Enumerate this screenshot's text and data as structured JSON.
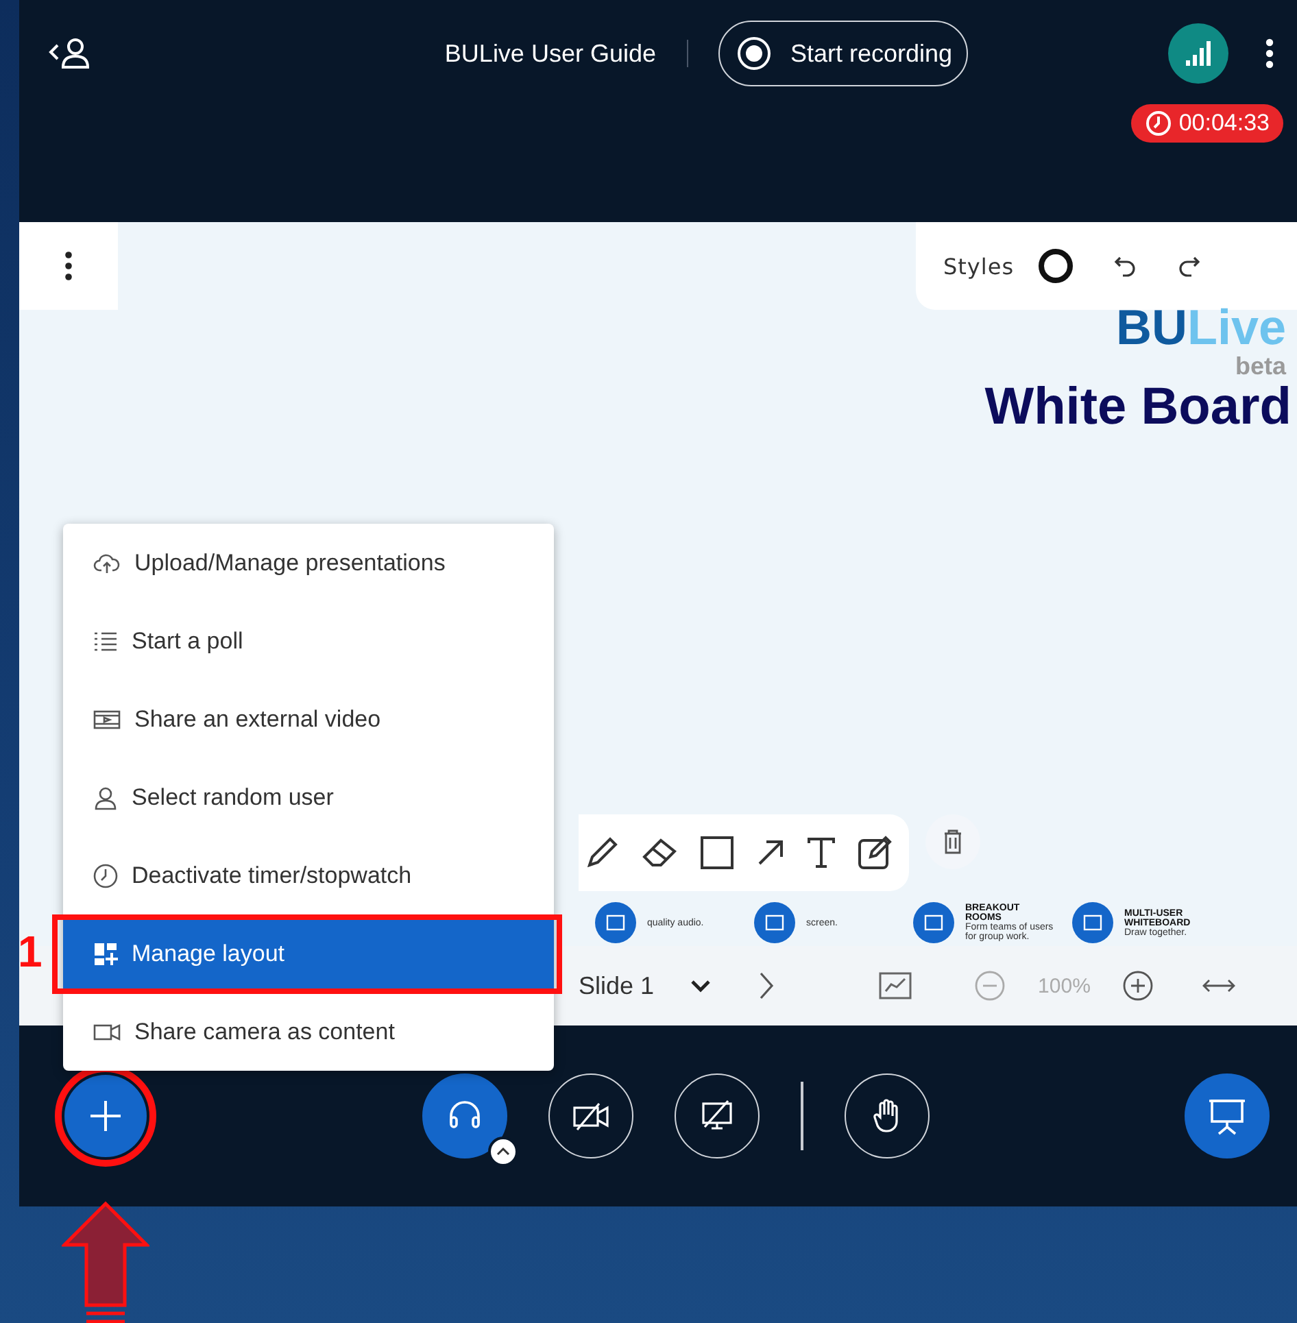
{
  "header": {
    "title": "BULive User Guide",
    "record_button": "Start recording",
    "timer": "00:04:33"
  },
  "whiteboard": {
    "styles_label": "Styles",
    "logo": {
      "brand": "BU",
      "product": "Live",
      "tag": "beta"
    },
    "heading": "White Board",
    "features": [
      {
        "text": "quality audio."
      },
      {
        "text": "screen."
      },
      {
        "title": "BREAKOUT ROOMS",
        "text": "Form teams of users for group work."
      },
      {
        "title": "MULTI-USER WHITEBOARD",
        "text": "Draw together."
      }
    ]
  },
  "slide_bar": {
    "slide": "Slide 1",
    "zoom": "100%"
  },
  "actions_menu": {
    "items": [
      {
        "kind": "upload",
        "label": "Upload/Manage presentations",
        "selected": false
      },
      {
        "kind": "poll",
        "label": "Start a poll",
        "selected": false
      },
      {
        "kind": "video",
        "label": "Share an external video",
        "selected": false
      },
      {
        "kind": "user",
        "label": "Select random user",
        "selected": false
      },
      {
        "kind": "timer",
        "label": "Deactivate timer/stopwatch",
        "selected": false
      },
      {
        "kind": "layout",
        "label": "Manage layout",
        "selected": true
      },
      {
        "kind": "camera",
        "label": "Share camera as content",
        "selected": false
      }
    ]
  },
  "annotation": {
    "step": "1"
  }
}
